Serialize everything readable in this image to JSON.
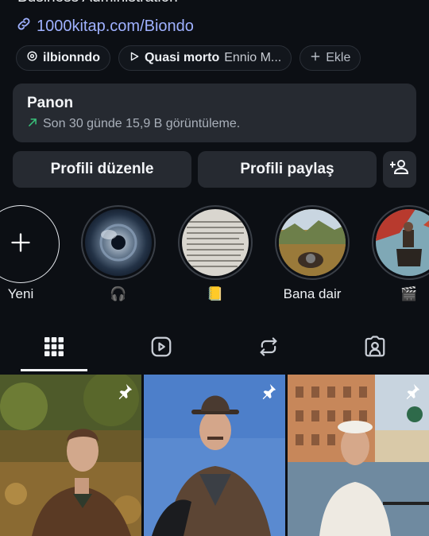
{
  "profile": {
    "category": "Business Administration",
    "link": "1000kitap.com/Biondo",
    "threads_chip": "ilbionndo",
    "music_title": "Quasi morto",
    "music_artist": "Ennio M...",
    "add_label": "Ekle"
  },
  "dashboard": {
    "title": "Panon",
    "subtitle": "Son 30 günde 15,9 B görüntüleme."
  },
  "buttons": {
    "edit": "Profili düzenle",
    "share": "Profili paylaş"
  },
  "highlights": [
    {
      "label": "Yeni"
    },
    {
      "label": "🎧"
    },
    {
      "label": "📒"
    },
    {
      "label": "Bana dair"
    },
    {
      "label": "🎬"
    }
  ],
  "colors": {
    "background": "#0c0f14",
    "accent_link": "#9fb1ff",
    "trend_green": "#39c07a",
    "surface": "#262a31"
  },
  "icons": {
    "tabs": [
      "grid-icon",
      "reels-icon",
      "reposts-icon",
      "tagged-icon"
    ],
    "pinned": "pin-icon"
  }
}
